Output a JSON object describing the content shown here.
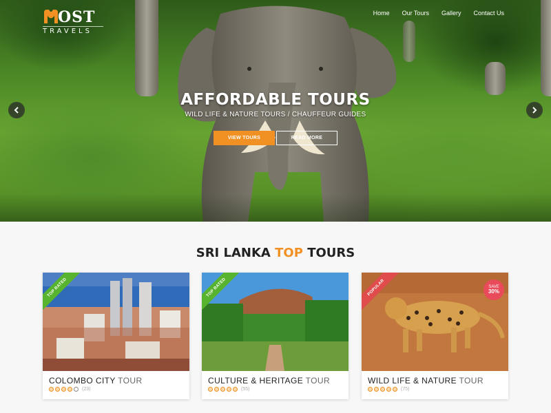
{
  "brand": {
    "name_main": "OST",
    "name_sub": "TRAVELS",
    "accent": "#f29123"
  },
  "nav": {
    "items": [
      "Home",
      "Our Tours",
      "Gallery",
      "Contact Us"
    ]
  },
  "hero": {
    "title": "AFFORDABLE TOURS",
    "subtitle": "WILD LIFE & NATURE TOURS / CHAUFFEUR GUIDES",
    "primary_button": "VIEW TOURS",
    "secondary_button": "READ MORE",
    "prev_icon": "chevron-left-icon",
    "next_icon": "chevron-right-icon"
  },
  "section": {
    "title_pre": "SRI LANKA",
    "title_highlight": "TOP",
    "title_post": "TOURS"
  },
  "cards": [
    {
      "title_bold": "COLOMBO CITY",
      "title_light": "TOUR",
      "ribbon": "TOP RATED",
      "rating": 4,
      "count": "(23)"
    },
    {
      "title_bold": "CULTURE & HERITAGE",
      "title_light": "TOUR",
      "ribbon": "TOP RATED",
      "rating": 5,
      "count": "(55)"
    },
    {
      "title_bold": "WILD LIFE & NATURE",
      "title_light": "TOUR",
      "ribbon": "POPULAR",
      "rating": 5,
      "count": "(75)",
      "badge_line1": "SAVE",
      "badge_line2": "30%"
    }
  ]
}
